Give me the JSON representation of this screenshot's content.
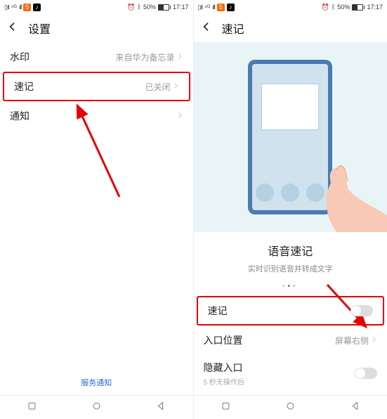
{
  "status": {
    "signal": "⁴ᴳ",
    "battery_text": "50%",
    "time": "17:17",
    "alarm": "⏰"
  },
  "left": {
    "title": "设置",
    "items": {
      "watermark": {
        "label": "水印",
        "value": "来自华为备忘录"
      },
      "quicknote": {
        "label": "速记",
        "value": "已关闭"
      },
      "notify": {
        "label": "通知",
        "value": ""
      }
    },
    "footer": "服务通知"
  },
  "right": {
    "title": "速记",
    "feature_title": "语音速记",
    "feature_sub": "实时识别语音并转成文字",
    "items": {
      "quicknote": {
        "label": "速记"
      },
      "entry": {
        "label": "入口位置",
        "value": "屏幕右侧"
      },
      "hide": {
        "label": "隐藏入口",
        "sub": "5 秒无操作后"
      }
    }
  }
}
